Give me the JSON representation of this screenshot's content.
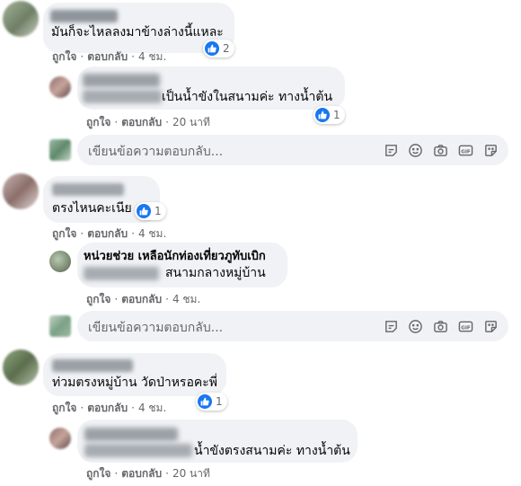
{
  "actions": {
    "like": "ถูกใจ",
    "reply": "ตอบกลับ",
    "sep": "·"
  },
  "comments": [
    {
      "text": "มันก็จะไหลลงมาข้างล่างนี้แหละ",
      "reactions": "2",
      "time": "4 ชม."
    },
    {
      "text": "เป็นน้ำขังในสนามค่ะ ทางน้ำต้น",
      "reactions": "1",
      "time": "20 นาที"
    },
    {
      "text": "ตรงไหนคะเนีย",
      "reactions": "1",
      "time": "4 ชม."
    },
    {
      "name": "หน่วยช่วย เหลือนักท่องเที่ยวภูทับเบิก",
      "text": "สนามกลางหมู่บ้าน",
      "time": "4 ชม."
    },
    {
      "text": "ท่วมตรงหมู่บ้าน วัดป่าหรอคะพี่",
      "reactions": "1",
      "time": "4 ชม."
    },
    {
      "text": "น้ำขังตรงสนามค่ะ ทางน้ำต้น",
      "time": "20 นาที"
    }
  ],
  "reply_box": {
    "placeholder": "เขียนข้อความตอบกลับ..."
  },
  "tool_icons": [
    "sticker-icon",
    "emoji-icon",
    "camera-icon",
    "gif-icon",
    "sticker-pack-icon"
  ],
  "colors": {
    "like_blue": "#1877f2",
    "bubble": "#f0f2f5",
    "meta": "#65676b"
  }
}
